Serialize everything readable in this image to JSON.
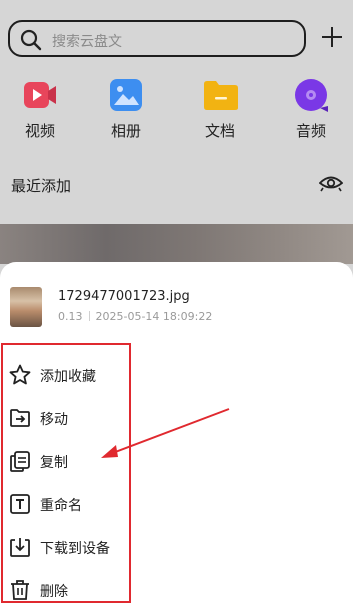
{
  "search": {
    "placeholder": "搜索云盘文"
  },
  "categories": [
    {
      "label": "视频",
      "icon": "video-icon",
      "color": "#e8455b"
    },
    {
      "label": "相册",
      "icon": "photo-album-icon",
      "color": "#3d8ef0"
    },
    {
      "label": "文档",
      "icon": "document-folder-icon",
      "color": "#f2b312"
    },
    {
      "label": "音频",
      "icon": "audio-disc-icon",
      "color": "#7a38e6"
    }
  ],
  "recent": {
    "label": "最近添加"
  },
  "file": {
    "name": "1729477001723.jpg",
    "size": "0.13",
    "date": "2025-05-14 18:09:22"
  },
  "menu": [
    {
      "label": "添加收藏",
      "icon": "star-icon"
    },
    {
      "label": "移动",
      "icon": "move-to-folder-icon"
    },
    {
      "label": "复制",
      "icon": "copy-icon"
    },
    {
      "label": "重命名",
      "icon": "rename-icon"
    },
    {
      "label": "下载到设备",
      "icon": "download-icon"
    },
    {
      "label": "删除",
      "icon": "trash-icon"
    }
  ],
  "annotation_color": "#e0292f"
}
